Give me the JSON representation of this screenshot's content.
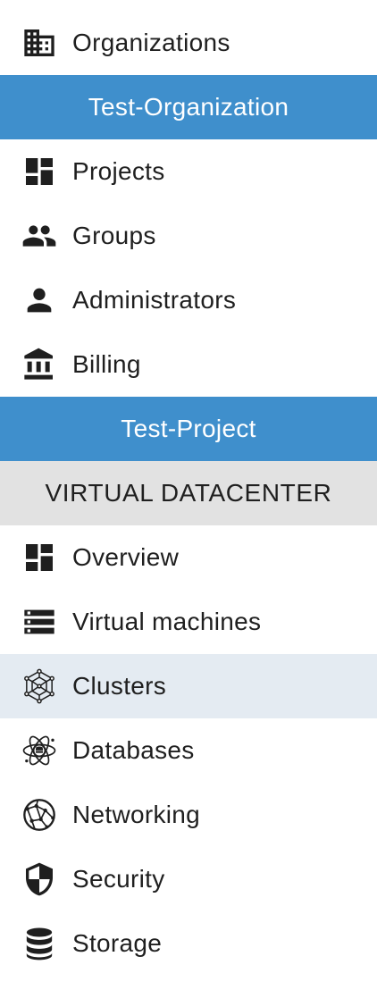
{
  "top": {
    "organizations_label": "Organizations"
  },
  "organization_header": "Test-Organization",
  "organization_items": [
    {
      "label": "Projects",
      "icon": "dashboard-icon"
    },
    {
      "label": "Groups",
      "icon": "people-icon"
    },
    {
      "label": "Administrators",
      "icon": "person-icon"
    },
    {
      "label": "Billing",
      "icon": "bank-icon"
    }
  ],
  "project_header": "Test-Project",
  "section_header": "VIRTUAL DATACENTER",
  "datacenter_items": [
    {
      "label": "Overview",
      "icon": "dashboard-icon"
    },
    {
      "label": "Virtual machines",
      "icon": "server-icon"
    },
    {
      "label": "Clusters",
      "icon": "cluster-icon",
      "active": true
    },
    {
      "label": "Databases",
      "icon": "database-atom-icon"
    },
    {
      "label": "Networking",
      "icon": "network-globe-icon"
    },
    {
      "label": "Security",
      "icon": "shield-icon"
    },
    {
      "label": "Storage",
      "icon": "storage-icon"
    }
  ],
  "colors": {
    "header_blue": "#3f8fcc",
    "section_gray": "#e2e2e2",
    "active_bg": "#e4ebf2",
    "text": "#1f1f1f"
  }
}
